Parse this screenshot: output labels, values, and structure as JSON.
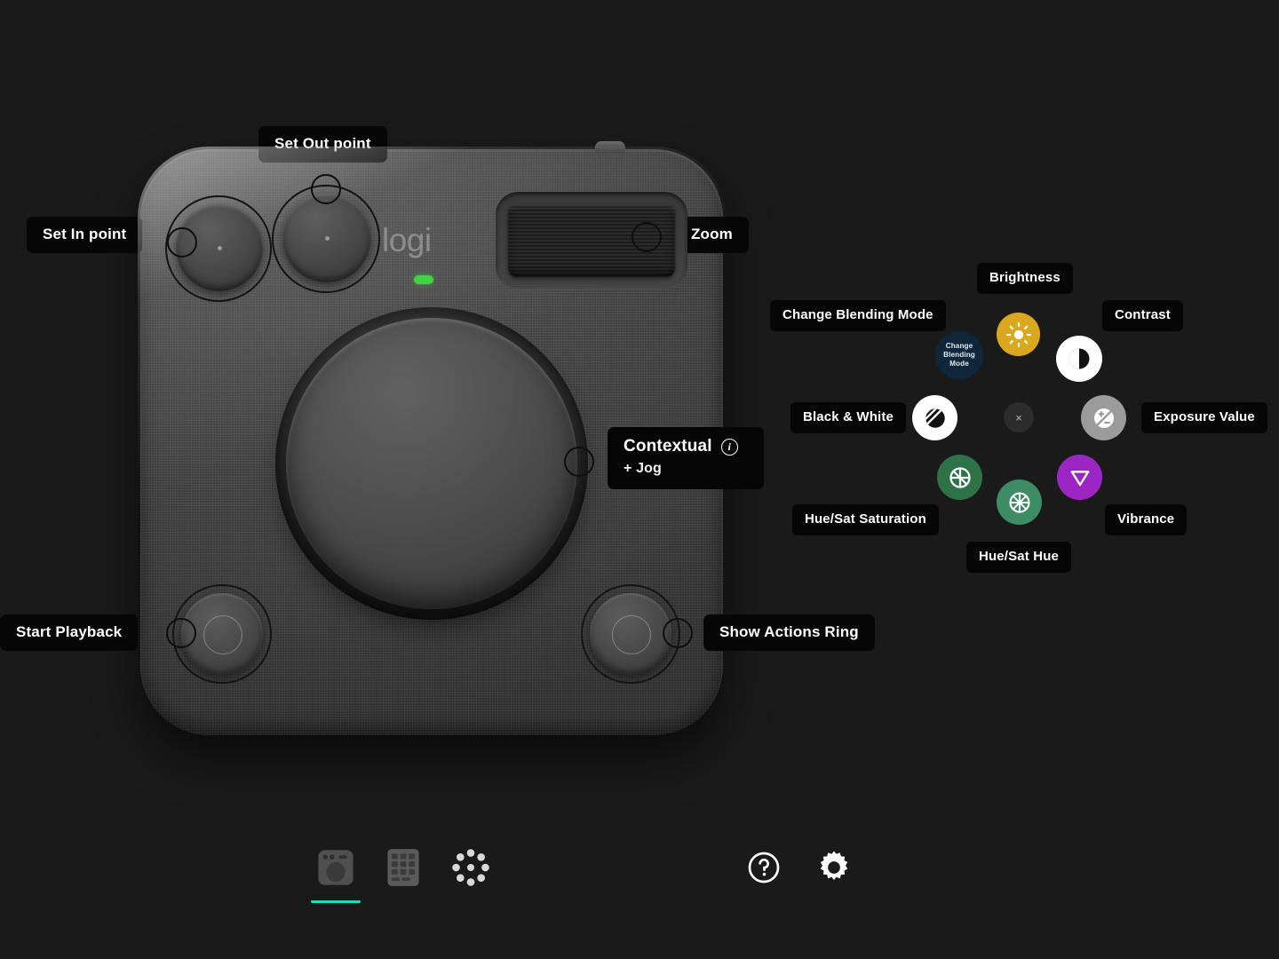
{
  "app": {
    "background_color": "#1a1a1a",
    "device_name": "logi",
    "device_brand_text": "logi"
  },
  "device_callouts": [
    {
      "id": "set-out-point",
      "label": "Set Out point"
    },
    {
      "id": "set-in-point",
      "label": "Set In point"
    },
    {
      "id": "zoom",
      "label": "Zoom"
    },
    {
      "id": "contextual",
      "label": "Contextual",
      "sublabel": "+ Jog",
      "info_icon": "i"
    },
    {
      "id": "start-playback",
      "label": "Start Playback"
    },
    {
      "id": "show-actions-ring",
      "label": "Show Actions Ring"
    }
  ],
  "actions_ring": {
    "center": {
      "icon": "close-icon",
      "glyph": "×"
    },
    "nodes": [
      {
        "id": "change-blending-mode",
        "label": "Change Blending Mode",
        "inner_text": "Change Blending Mode",
        "icon": "text-badge-icon",
        "color": "#10263a"
      },
      {
        "id": "brightness",
        "label": "Brightness",
        "icon": "sun-icon",
        "color": "#d9a81f"
      },
      {
        "id": "contrast",
        "label": "Contrast",
        "icon": "contrast-half-circle-icon",
        "color": "#ffffff"
      },
      {
        "id": "black-and-white",
        "label": "Black & White",
        "icon": "black-white-striped-circle-icon",
        "color": "#ffffff"
      },
      {
        "id": "exposure-value",
        "label": "Exposure Value",
        "icon": "exposure-plus-minus-icon",
        "color": "#9b9b9b"
      },
      {
        "id": "hue-sat-saturation",
        "label": "Hue/Sat Saturation",
        "icon": "color-wheel-4-spoke-icon",
        "color": "#2d7347"
      },
      {
        "id": "hue-sat-hue",
        "label": "Hue/Sat Hue",
        "icon": "color-wheel-8-spoke-icon",
        "color": "#3e8c63"
      },
      {
        "id": "vibrance",
        "label": "Vibrance",
        "icon": "triangle-down-icon",
        "color": "#9b26c4"
      }
    ]
  },
  "toolbar": {
    "active_accent_color": "#2ad6b8",
    "items": [
      {
        "id": "device",
        "icon": "console-dial-icon",
        "active": true
      },
      {
        "id": "keypad",
        "icon": "keypad-grid-icon",
        "active": false
      },
      {
        "id": "actions-ring",
        "icon": "dots-ring-icon",
        "active": false
      }
    ],
    "right_items": [
      {
        "id": "help",
        "icon": "question-mark-circle-icon"
      },
      {
        "id": "settings",
        "icon": "gear-icon"
      }
    ]
  }
}
